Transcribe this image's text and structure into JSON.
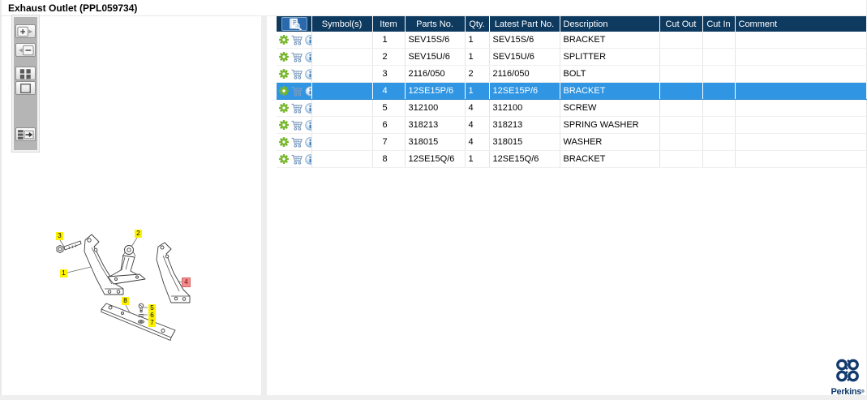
{
  "window": {
    "title": "Exhaust Outlet (PPL059734)"
  },
  "toolbar": {
    "buttons": [
      {
        "name": "zoom-in"
      },
      {
        "name": "zoom-out"
      },
      {
        "name": "fit-view"
      },
      {
        "name": "zoom-region"
      },
      {
        "name": "toggle-table-panel"
      }
    ]
  },
  "table": {
    "header_icon": "document-magnifier-icon",
    "row_icons": [
      "gear-icon",
      "cart-icon",
      "info-icon"
    ],
    "columns": [
      {
        "label": ""
      },
      {
        "label": "Symbol(s)"
      },
      {
        "label": "Item"
      },
      {
        "label": "Parts No."
      },
      {
        "label": "Qty."
      },
      {
        "label": "Latest Part No."
      },
      {
        "label": "Description"
      },
      {
        "label": "Cut Out"
      },
      {
        "label": "Cut In"
      },
      {
        "label": "Comment"
      }
    ],
    "rows": [
      {
        "symbols": "",
        "item": "1",
        "parts_no": "SEV15S/6",
        "qty": "1",
        "latest_part_no": "SEV15S/6",
        "description": "BRACKET",
        "cut_out": "",
        "cut_in": "",
        "comment": "",
        "selected": false
      },
      {
        "symbols": "",
        "item": "2",
        "parts_no": "SEV15U/6",
        "qty": "1",
        "latest_part_no": "SEV15U/6",
        "description": "SPLITTER",
        "cut_out": "",
        "cut_in": "",
        "comment": "",
        "selected": false
      },
      {
        "symbols": "",
        "item": "3",
        "parts_no": "2116/050",
        "qty": "2",
        "latest_part_no": "2116/050",
        "description": "BOLT",
        "cut_out": "",
        "cut_in": "",
        "comment": "",
        "selected": false
      },
      {
        "symbols": "",
        "item": "4",
        "parts_no": "12SE15P/6",
        "qty": "1",
        "latest_part_no": "12SE15P/6",
        "description": "BRACKET",
        "cut_out": "",
        "cut_in": "",
        "comment": "",
        "selected": true
      },
      {
        "symbols": "",
        "item": "5",
        "parts_no": "312100",
        "qty": "4",
        "latest_part_no": "312100",
        "description": "SCREW",
        "cut_out": "",
        "cut_in": "",
        "comment": "",
        "selected": false
      },
      {
        "symbols": "",
        "item": "6",
        "parts_no": "318213",
        "qty": "4",
        "latest_part_no": "318213",
        "description": "SPRING WASHER",
        "cut_out": "",
        "cut_in": "",
        "comment": "",
        "selected": false
      },
      {
        "symbols": "",
        "item": "7",
        "parts_no": "318015",
        "qty": "4",
        "latest_part_no": "318015",
        "description": "WASHER",
        "cut_out": "",
        "cut_in": "",
        "comment": "",
        "selected": false
      },
      {
        "symbols": "",
        "item": "8",
        "parts_no": "12SE15Q/6",
        "qty": "1",
        "latest_part_no": "12SE15Q/6",
        "description": "BRACKET",
        "cut_out": "",
        "cut_in": "",
        "comment": "",
        "selected": false
      }
    ]
  },
  "diagram": {
    "labels": [
      {
        "text": "3",
        "highlight": false
      },
      {
        "text": "2",
        "highlight": false
      },
      {
        "text": "1",
        "highlight": false
      },
      {
        "text": "4",
        "highlight": true
      },
      {
        "text": "8",
        "highlight": false
      },
      {
        "text": "5",
        "highlight": false
      },
      {
        "text": "6",
        "highlight": false
      },
      {
        "text": "7",
        "highlight": false
      }
    ]
  },
  "logo": {
    "name": "Perkins",
    "registered": "®"
  },
  "colors": {
    "header_bg": "#0e3a5f",
    "selected_row": "#3095e2",
    "gear_green": "#76b629",
    "cart_blue": "#7e9cc0",
    "callout_yellow": "#fcf200",
    "callout_red": "#f08c8c",
    "logo_navy": "#123a6d"
  }
}
